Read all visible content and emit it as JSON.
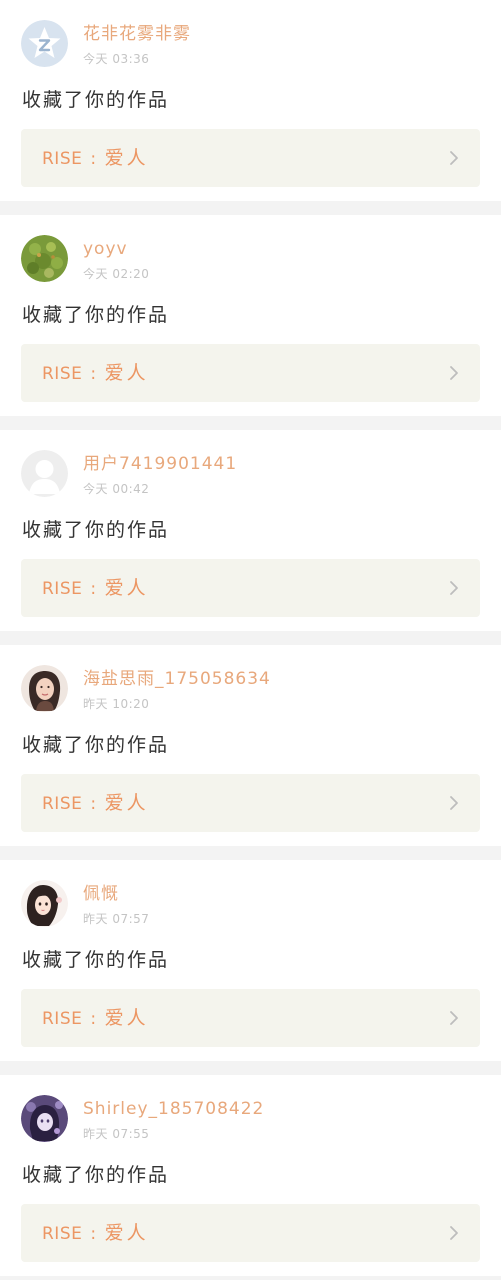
{
  "feed": {
    "items": [
      {
        "username": "花非花雾非雾",
        "time": "今天 03:36",
        "action": "收藏了你的作品",
        "work": {
          "prefix": "RISE",
          "separator": ":",
          "title": "爱人"
        },
        "avatar": "default-star-avatar"
      },
      {
        "username": "yoyv",
        "time": "今天 02:20",
        "action": "收藏了你的作品",
        "work": {
          "prefix": "RISE",
          "separator": ":",
          "title": "爱人"
        },
        "avatar": "grass-photo-avatar"
      },
      {
        "username": "用户7419901441",
        "time": "今天 00:42",
        "action": "收藏了你的作品",
        "work": {
          "prefix": "RISE",
          "separator": ":",
          "title": "爱人"
        },
        "avatar": "default-person-avatar"
      },
      {
        "username": "海盐思雨_175058634",
        "time": "昨天 10:20",
        "action": "收藏了你的作品",
        "work": {
          "prefix": "RISE",
          "separator": ":",
          "title": "爱人"
        },
        "avatar": "woman-photo-avatar"
      },
      {
        "username": "佩慨",
        "time": "昨天 07:57",
        "action": "收藏了你的作品",
        "work": {
          "prefix": "RISE",
          "separator": ":",
          "title": "爱人"
        },
        "avatar": "illustrated-girl-avatar"
      },
      {
        "username": "Shirley_185708422",
        "time": "昨天 07:55",
        "action": "收藏了你的作品",
        "work": {
          "prefix": "RISE",
          "separator": ":",
          "title": "爱人"
        },
        "avatar": "purple-anime-avatar"
      }
    ]
  },
  "colors": {
    "username": "#e8a87c",
    "time": "#c4c4c4",
    "action": "#333333",
    "work_text": "#ec9663",
    "work_background": "#f4f4ed",
    "separator_background": "#f3f3f3"
  }
}
